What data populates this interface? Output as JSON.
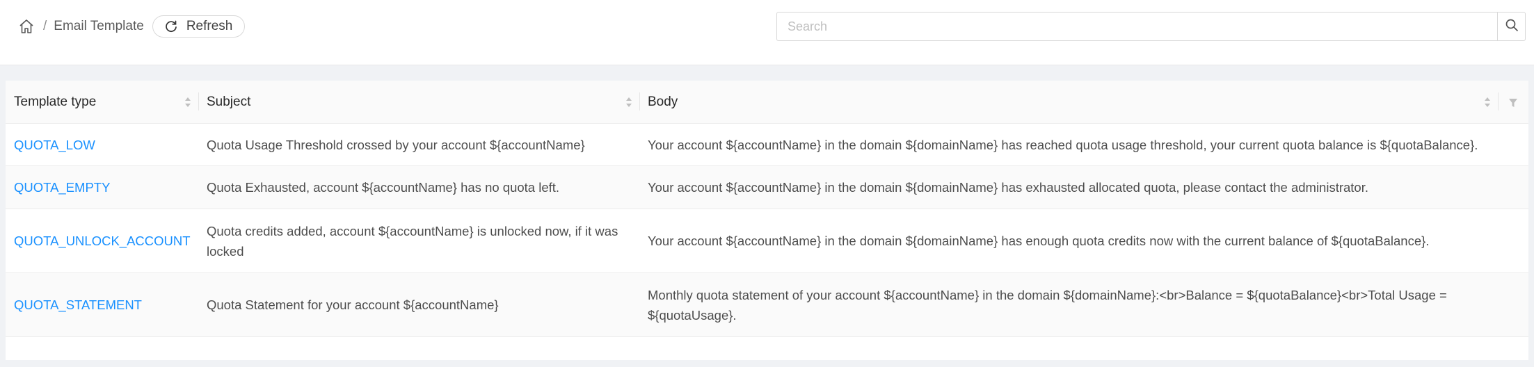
{
  "breadcrumb": {
    "home_icon": "home-icon",
    "current": "Email Template"
  },
  "refresh": {
    "label": "Refresh",
    "icon": "reload-icon"
  },
  "search": {
    "placeholder": "Search",
    "value": "",
    "icon": "search-icon"
  },
  "table": {
    "columns": [
      "Template type",
      "Subject",
      "Body"
    ],
    "rows": [
      {
        "type": "QUOTA_LOW",
        "subject": "Quota Usage Threshold crossed by your account ${accountName}",
        "body": "Your account ${accountName} in the domain ${domainName} has reached quota usage threshold, your current quota balance is ${quotaBalance}."
      },
      {
        "type": "QUOTA_EMPTY",
        "subject": "Quota Exhausted, account ${accountName} has no quota left.",
        "body": "Your account ${accountName} in the domain ${domainName} has exhausted allocated quota, please contact the administrator."
      },
      {
        "type": "QUOTA_UNLOCK_ACCOUNT",
        "subject": "Quota credits added, account ${accountName} is unlocked now, if it was locked",
        "body": "Your account ${accountName} in the domain ${domainName} has enough quota credits now with the current balance of ${quotaBalance}."
      },
      {
        "type": "QUOTA_STATEMENT",
        "subject": "Quota Statement for your account ${accountName}",
        "body": "Monthly quota statement of your account ${accountName} in the domain ${domainName}:<br>Balance = ${quotaBalance}<br>Total Usage = ${quotaUsage}."
      }
    ]
  },
  "colors": {
    "link": "#1890ff",
    "page_bg": "#f0f2f5",
    "header_bg": "#fafafa"
  }
}
